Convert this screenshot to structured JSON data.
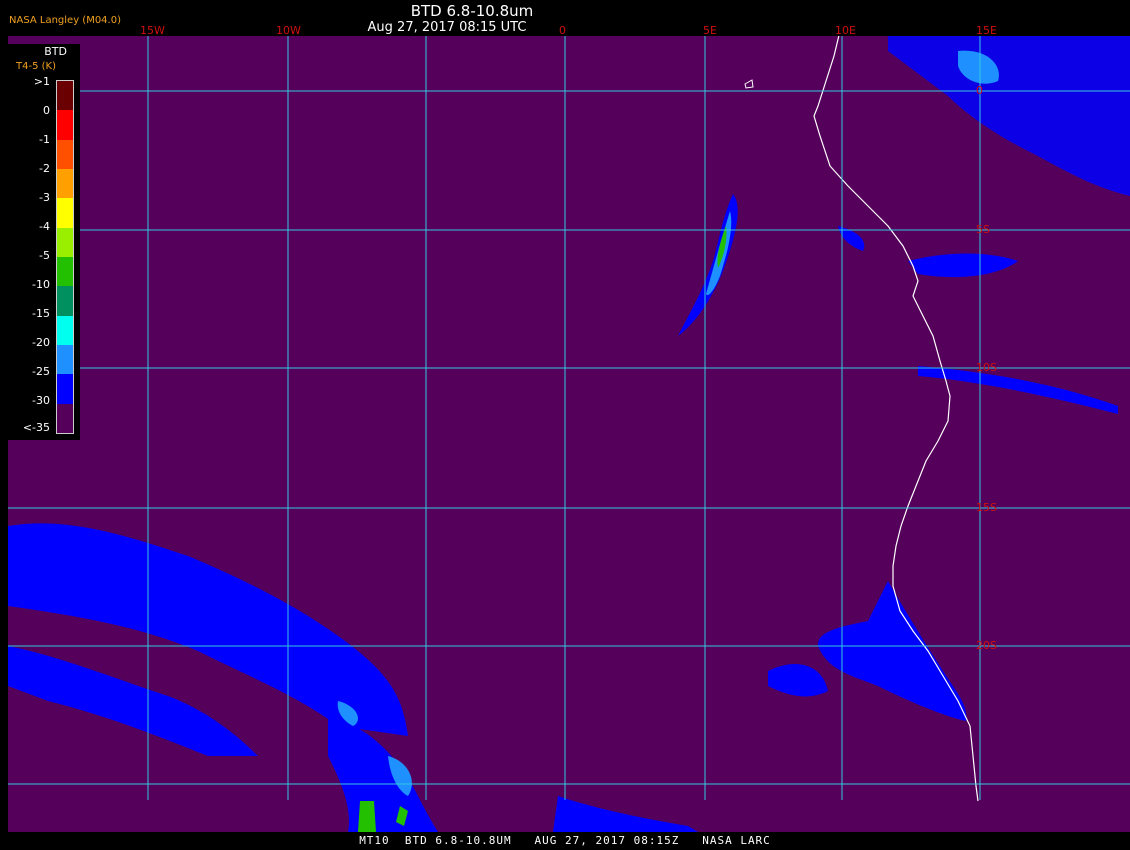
{
  "header": {
    "title": "BTD 6.8-10.8um",
    "datetime": "Aug 27, 2017 08:15 UTC",
    "credit": "NASA Langley (M04.0)"
  },
  "legend": {
    "title": "BTD",
    "units": "T4-5 (K)",
    "items": [
      {
        "label": ">1",
        "color": "#6a0000"
      },
      {
        "label": "0",
        "color": "#ff0000"
      },
      {
        "label": "-1",
        "color": "#ff5000"
      },
      {
        "label": "-2",
        "color": "#ff9f00"
      },
      {
        "label": "-3",
        "color": "#ffff00"
      },
      {
        "label": "-4",
        "color": "#9aee00"
      },
      {
        "label": "-5",
        "color": "#22c000"
      },
      {
        "label": "-10",
        "color": "#009060"
      },
      {
        "label": "-15",
        "color": "#00ffee"
      },
      {
        "label": "-20",
        "color": "#1e90ff"
      },
      {
        "label": "-25",
        "color": "#0000ff"
      },
      {
        "label": "-30",
        "color": "#55005a"
      },
      {
        "label": "<-35",
        "color": ""
      }
    ]
  },
  "grid": {
    "longitude_labels": [
      "15W",
      "10W",
      "0",
      "5E",
      "10E",
      "15E"
    ],
    "latitude_labels": [
      "0",
      "5S",
      "10S",
      "15S",
      "20S"
    ]
  },
  "colors": {
    "background": "#55005a",
    "gridline": "#33c8e0",
    "grid_label": "#d01010",
    "coastline": "#ffffff",
    "low_btd": "#0000ff",
    "mid_btd": "#1e90ff"
  },
  "footer": {
    "text": "MT10  BTD 6.8-10.8UM   AUG 27, 2017 08:15Z   NASA LARC"
  }
}
